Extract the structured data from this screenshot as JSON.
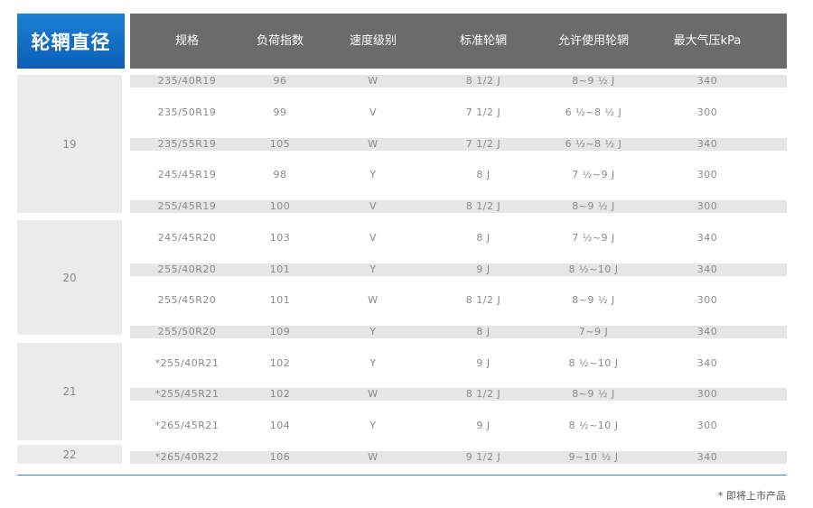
{
  "header": {
    "title": "轮辋直径",
    "columns": [
      "规格",
      "负荷指数",
      "速度级别",
      "标准轮辋",
      "允许使用轮辋",
      "最大气压kPa"
    ]
  },
  "groups": [
    {
      "label": "19",
      "rows": [
        {
          "spec": "235/40R19",
          "load": "96",
          "speed": "W",
          "std_rim": "8 1/2 J",
          "allowed_rim": "8~9 ½ J",
          "pressure": "340"
        },
        {
          "spec": "235/50R19",
          "load": "99",
          "speed": "V",
          "std_rim": "7 1/2 J",
          "allowed_rim": "6 ½~8 ½ J",
          "pressure": "300"
        },
        {
          "spec": "235/55R19",
          "load": "105",
          "speed": "W",
          "std_rim": "7 1/2 J",
          "allowed_rim": "6 ½~8 ½ J",
          "pressure": "340"
        },
        {
          "spec": "245/45R19",
          "load": "98",
          "speed": "Y",
          "std_rim": "8 J",
          "allowed_rim": "7 ½~9 J",
          "pressure": "300"
        },
        {
          "spec": "255/45R19",
          "load": "100",
          "speed": "V",
          "std_rim": "8 1/2 J",
          "allowed_rim": "8~9 ½ J",
          "pressure": "300"
        }
      ]
    },
    {
      "label": "20",
      "rows": [
        {
          "spec": "245/45R20",
          "load": "103",
          "speed": "V",
          "std_rim": "8 J",
          "allowed_rim": "7 ½~9 J",
          "pressure": "340"
        },
        {
          "spec": "255/40R20",
          "load": "101",
          "speed": "Y",
          "std_rim": "9 J",
          "allowed_rim": "8 ½~10 J",
          "pressure": "340"
        },
        {
          "spec": "255/45R20",
          "load": "101",
          "speed": "W",
          "std_rim": "8 1/2 J",
          "allowed_rim": "8~9 ½ J",
          "pressure": "300"
        },
        {
          "spec": "255/50R20",
          "load": "109",
          "speed": "Y",
          "std_rim": "8 J",
          "allowed_rim": "7~9 J",
          "pressure": "340"
        }
      ]
    },
    {
      "label": "21",
      "rows": [
        {
          "spec": "*255/40R21",
          "load": "102",
          "speed": "Y",
          "std_rim": "9 J",
          "allowed_rim": "8 ½~10 J",
          "pressure": "340"
        },
        {
          "spec": "*255/45R21",
          "load": "102",
          "speed": "W",
          "std_rim": "8 1/2 J",
          "allowed_rim": "8~9 ½ J",
          "pressure": "300"
        },
        {
          "spec": "*265/45R21",
          "load": "104",
          "speed": "Y",
          "std_rim": "9 J",
          "allowed_rim": "8 ½~10 J",
          "pressure": "300"
        }
      ]
    },
    {
      "label": "22",
      "rows": [
        {
          "spec": "*265/40R22",
          "load": "106",
          "speed": "W",
          "std_rim": "9 1/2 J",
          "allowed_rim": "9~10 ½ J",
          "pressure": "340"
        }
      ]
    }
  ],
  "footnote": "* 即将上市产品"
}
